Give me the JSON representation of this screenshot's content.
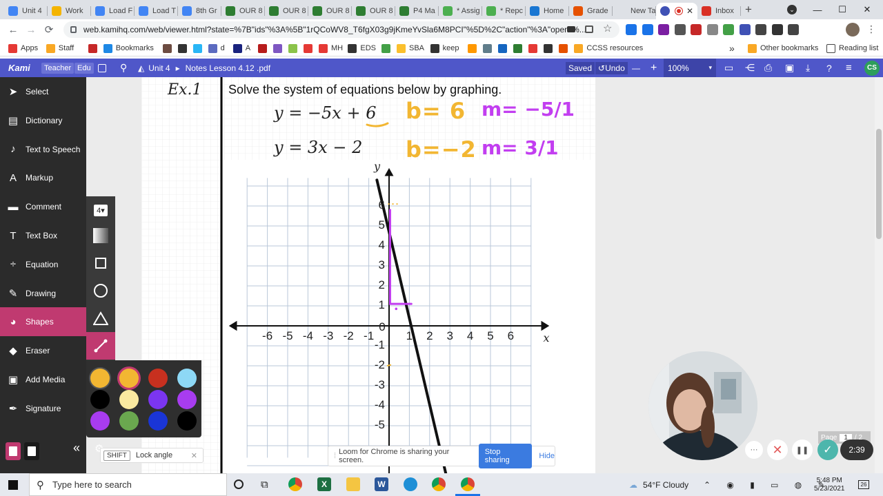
{
  "browser": {
    "tabs": [
      {
        "label": "Unit 4",
        "color": "#4285f4"
      },
      {
        "label": "Work",
        "color": "#f4b400"
      },
      {
        "label": "Load F",
        "color": "#4285f4"
      },
      {
        "label": "Load T",
        "color": "#4285f4"
      },
      {
        "label": "8th Gr",
        "color": "#4285f4"
      },
      {
        "label": "OUR 8",
        "color": "#2e7d32"
      },
      {
        "label": "OUR 8",
        "color": "#2e7d32"
      },
      {
        "label": "OUR 8",
        "color": "#2e7d32"
      },
      {
        "label": "OUR 8",
        "color": "#2e7d32"
      },
      {
        "label": "P4 Ma",
        "color": "#2e7d32"
      },
      {
        "label": "* Assig",
        "color": "#4caf50"
      },
      {
        "label": "* Repc",
        "color": "#4caf50"
      },
      {
        "label": "Home",
        "color": "#1976d2"
      },
      {
        "label": "Grade",
        "color": "#e65100"
      },
      {
        "label": "New Tab",
        "color": "#dee1e6"
      },
      {
        "label": "",
        "color": "#3f51b5",
        "active": true
      },
      {
        "label": "Inbox",
        "color": "#d93025"
      }
    ],
    "new_tab": "+",
    "window": {
      "minimize": "—",
      "maximize": "☐",
      "close": "✕",
      "tab_search": "⌄"
    },
    "url": "web.kamihq.com/web/viewer.html?state=%7B\"ids\"%3A%5B\"1rQCoWV8_T6fgX03g9jKmeYvSla6M8PCI\"%5D%2C\"action\"%3A\"open\"%...",
    "nav": {
      "back": "←",
      "forward": "→",
      "reload": "⟳"
    },
    "bookmarks": [
      {
        "label": "Apps",
        "color": "#e53935"
      },
      {
        "label": "Staff",
        "color": "#f9a825"
      },
      {
        "label": "",
        "color": "#c62828"
      },
      {
        "label": "Bookmarks",
        "color": "#1e88e5"
      },
      {
        "label": "",
        "color": "#6d4c41"
      },
      {
        "label": "",
        "color": "#333"
      },
      {
        "label": "",
        "color": "#29b6f6"
      },
      {
        "label": "d",
        "color": "#5c6bc0"
      },
      {
        "label": "A",
        "color": "#1a237e"
      },
      {
        "label": "",
        "color": "#b71c1c"
      },
      {
        "label": "",
        "color": "#7e57c2"
      },
      {
        "label": "",
        "color": "#8bc34a"
      },
      {
        "label": "",
        "color": "#e53935"
      },
      {
        "label": "MH",
        "color": "#e53935"
      },
      {
        "label": "EDS",
        "color": "#333"
      },
      {
        "label": "",
        "color": "#43a047"
      },
      {
        "label": "SBA",
        "color": "#fbc02d"
      },
      {
        "label": "keep",
        "color": "#333"
      },
      {
        "label": "",
        "color": "#ff9800"
      },
      {
        "label": "",
        "color": "#607d8b"
      },
      {
        "label": "",
        "color": "#1565c0"
      },
      {
        "label": "",
        "color": "#2e7d32"
      },
      {
        "label": "",
        "color": "#e53935"
      },
      {
        "label": "",
        "color": "#333"
      },
      {
        "label": "",
        "color": "#e65100"
      },
      {
        "label": "CCSS resources",
        "color": "#f9a825"
      }
    ],
    "bookmarks_more": "»",
    "other_bookmarks": "Other bookmarks",
    "reading_list": "Reading list"
  },
  "kami": {
    "logo": "Kami",
    "role": "Teacher",
    "edu": "Edu",
    "breadcrumb_folder": "Unit 4",
    "breadcrumb_sep": "▸",
    "file_name": "Notes Lesson 4.12 .pdf",
    "saved": "Saved",
    "undo": "Undo",
    "zoom": "100%",
    "zoom_minus": "—",
    "zoom_plus": "+",
    "avatar": "CS"
  },
  "sidebar": {
    "items": [
      {
        "label": "Select",
        "icon": "cursor-icon"
      },
      {
        "label": "Dictionary",
        "icon": "book-icon"
      },
      {
        "label": "Text to Speech",
        "icon": "speech-icon"
      },
      {
        "label": "Markup",
        "icon": "markup-icon"
      },
      {
        "label": "Comment",
        "icon": "comment-icon"
      },
      {
        "label": "Text Box",
        "icon": "textbox-icon"
      },
      {
        "label": "Equation",
        "icon": "equation-icon"
      },
      {
        "label": "Drawing",
        "icon": "pen-icon"
      },
      {
        "label": "Shapes",
        "icon": "shapes-icon",
        "active": true
      },
      {
        "label": "Eraser",
        "icon": "eraser-icon"
      },
      {
        "label": "Add Media",
        "icon": "media-icon"
      },
      {
        "label": "Signature",
        "icon": "signature-icon"
      }
    ],
    "collapse": "«"
  },
  "shape_tools": {
    "stroke_size": "4",
    "colors": [
      "#f2b632",
      "#f2b632",
      "#c7301f",
      "#8dd8f5",
      "#000000",
      "#f9e9a0",
      "#7b35f0",
      "#a83cf0",
      "#a83cf0",
      "#6aa84f",
      "#1a35d6",
      "#000000"
    ]
  },
  "tooltip": {
    "key": "SHIFT",
    "label": "Lock angle",
    "close": "✕"
  },
  "document": {
    "example_label": "Ex.1",
    "instruction": "Solve the system of equations below by graphing.",
    "eq1": "y = −5x + 6",
    "eq2": "y = 3x − 2",
    "annotations": {
      "b1": "b= 6",
      "m1": "m= −5/1",
      "b2": "b=−2",
      "m2": "m= 3/1"
    },
    "graph": {
      "x_label": "x",
      "y_label": "y",
      "x_ticks": [
        "-6",
        "-5",
        "-4",
        "-3",
        "-2",
        "-1",
        "0",
        "1",
        "2",
        "3",
        "4",
        "5",
        "6"
      ],
      "y_ticks_pos": [
        "1",
        "2",
        "3",
        "4",
        "5",
        "6"
      ],
      "y_ticks_neg": [
        "-1",
        "-2",
        "-3",
        "-4",
        "-5"
      ]
    }
  },
  "loom": {
    "message": "Loom for Chrome is sharing your screen.",
    "stop": "Stop sharing",
    "hide": "Hide",
    "timer": "2:39",
    "more": "···",
    "pause": "❚❚",
    "page_label": "Page",
    "page_num": "1",
    "page_total": "/ 2"
  },
  "taskbar": {
    "search_placeholder": "Type here to search",
    "weather": "54°F  Cloudy",
    "time": "5:48 PM",
    "date": "5/23/2021",
    "notifications": "26"
  }
}
